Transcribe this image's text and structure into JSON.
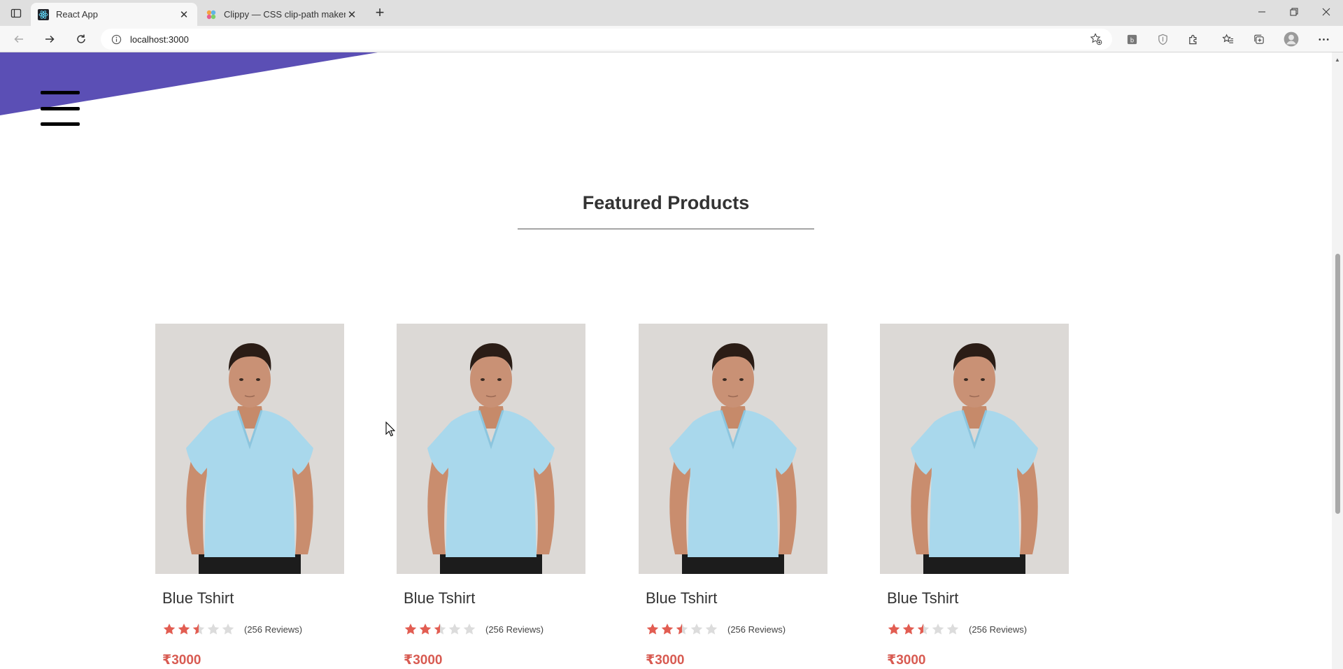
{
  "browser": {
    "tabs": [
      {
        "title": "React App",
        "favicon": "react-icon",
        "active": true
      },
      {
        "title": "Clippy — CSS clip-path maker",
        "favicon": "clippy-icon",
        "active": false
      }
    ],
    "address_bar": {
      "url": "localhost:3000"
    }
  },
  "page": {
    "accent_color": "#5b4fb5",
    "section_title": "Featured Products",
    "products": [
      {
        "name": "Blue Tshirt",
        "rating": 2.5,
        "reviews": "(256 Reviews)",
        "price": "₹3000"
      },
      {
        "name": "Blue Tshirt",
        "rating": 2.5,
        "reviews": "(256 Reviews)",
        "price": "₹3000"
      },
      {
        "name": "Blue Tshirt",
        "rating": 2.5,
        "reviews": "(256 Reviews)",
        "price": "₹3000"
      },
      {
        "name": "Blue Tshirt",
        "rating": 2.5,
        "reviews": "(256 Reviews)",
        "price": "₹3000"
      }
    ]
  }
}
